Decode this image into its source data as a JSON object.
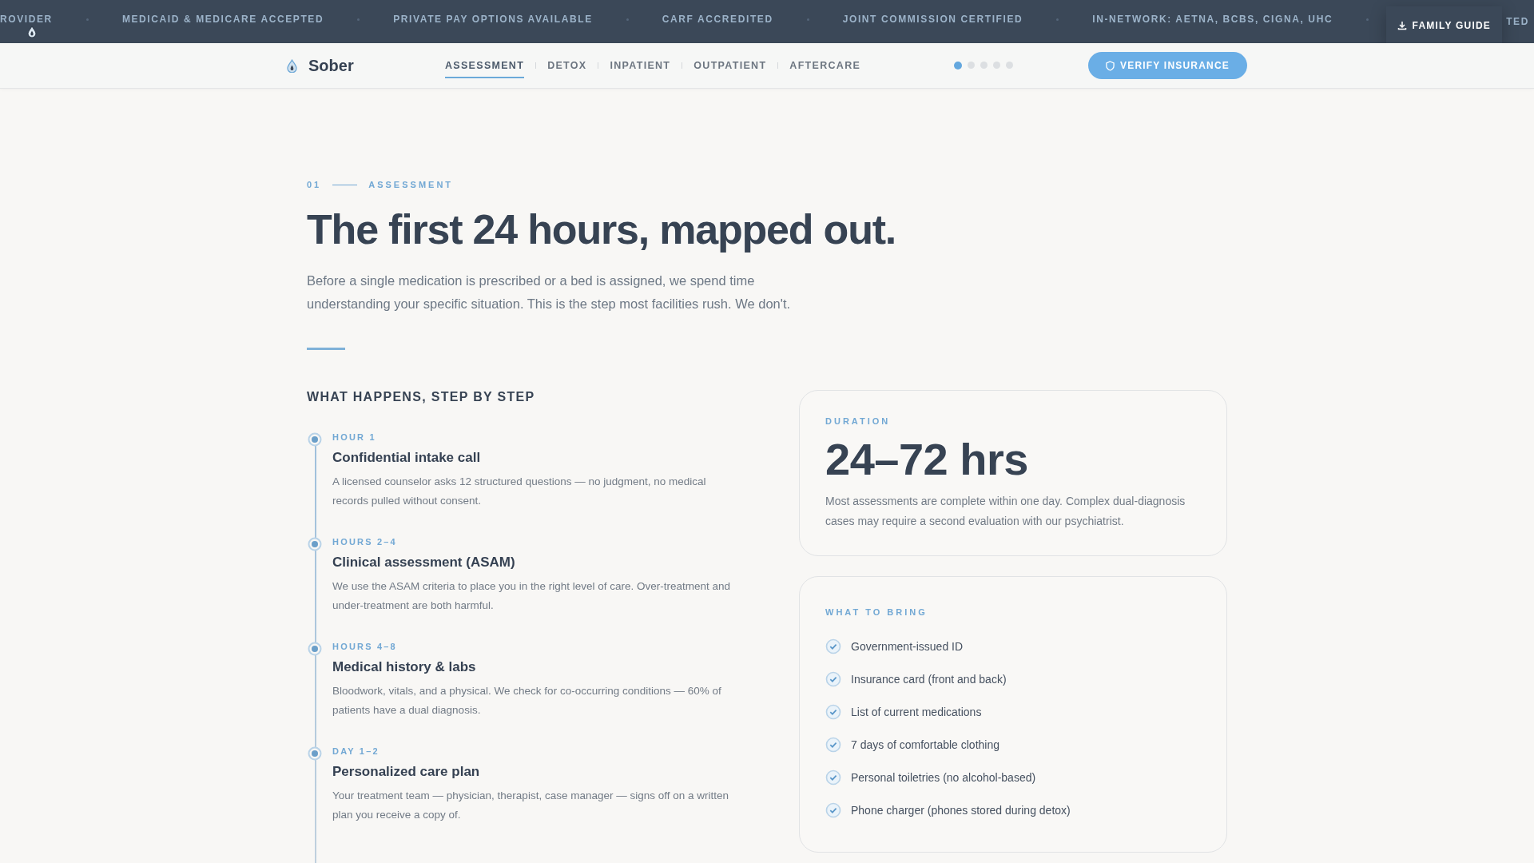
{
  "ticker": {
    "items": [
      "ROVIDER",
      "MEDICAID & MEDICARE ACCEPTED",
      "PRIVATE PAY OPTIONS AVAILABLE",
      "CARF ACCREDITED",
      "JOINT COMMISSION CERTIFIED",
      "IN-NETWORK: AETNA, BCBS, CIGNA, UHC",
      "TED"
    ],
    "family_guide": "FAMILY GUIDE"
  },
  "nav": {
    "brand": "Sober",
    "tabs": [
      {
        "label": "ASSESSMENT",
        "selected": true
      },
      {
        "label": "DETOX",
        "selected": false
      },
      {
        "label": "INPATIENT",
        "selected": false
      },
      {
        "label": "OUTPATIENT",
        "selected": false
      },
      {
        "label": "AFTERCARE",
        "selected": false
      }
    ],
    "progress_dots": [
      {
        "selected": true
      },
      {
        "selected": false
      },
      {
        "selected": false
      },
      {
        "selected": false
      },
      {
        "selected": false
      }
    ],
    "cta": "VERIFY INSURANCE"
  },
  "section": {
    "number": "01",
    "eyebrow": "ASSESSMENT",
    "title": "The first 24 hours, mapped out.",
    "intro": "Before a single medication is prescribed or a bed is assigned, we spend time understanding your specific situation. This is the step most facilities rush. We don't.",
    "steps_heading": "WHAT HAPPENS, STEP BY STEP",
    "steps": [
      {
        "time": "HOUR 1",
        "title": "Confidential intake call",
        "description": "A licensed counselor asks 12 structured questions — no judgment, no medical records pulled without consent."
      },
      {
        "time": "HOURS 2–4",
        "title": "Clinical assessment (ASAM)",
        "description": "We use the ASAM criteria to place you in the right level of care. Over-treatment and under-treatment are both harmful."
      },
      {
        "time": "HOURS 4–8",
        "title": "Medical history & labs",
        "description": "Bloodwork, vitals, and a physical. We check for co-occurring conditions — 60% of patients have a dual diagnosis."
      },
      {
        "time": "DAY 1–2",
        "title": "Personalized care plan",
        "description": "Your treatment team — physician, therapist, case manager — signs off on a written plan you receive a copy of."
      }
    ],
    "duration_card": {
      "label": "DURATION",
      "value": "24–72 hrs",
      "description": "Most assessments are complete within one day. Complex dual-diagnosis cases may require a second evaluation with our psychiatrist."
    },
    "bring_card": {
      "label": "WHAT TO BRING",
      "items": [
        {
          "text": "Government-issued ID",
          "checked": true
        },
        {
          "text": "Insurance card (front and back)",
          "checked": true
        },
        {
          "text": "List of current medications",
          "checked": true
        },
        {
          "text": "7 days of comfortable clothing",
          "checked": true
        },
        {
          "text": "Personal toiletries (no alcohol-based)",
          "checked": true
        },
        {
          "text": "Phone charger (phones stored during detox)",
          "checked": true
        }
      ]
    }
  }
}
